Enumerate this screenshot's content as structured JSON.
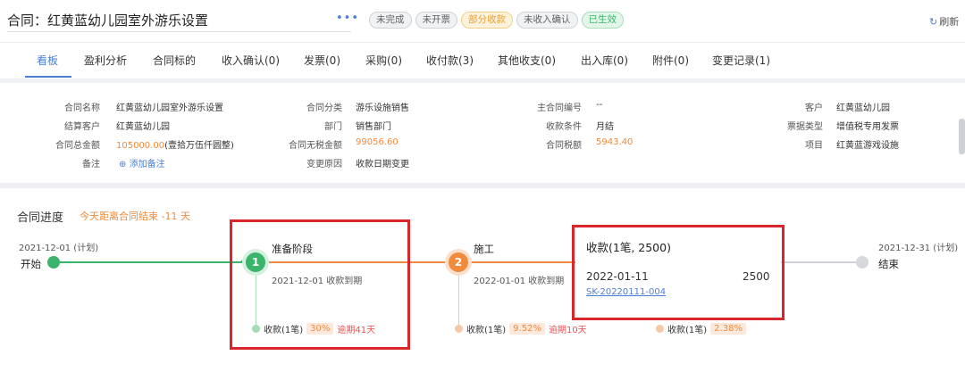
{
  "header": {
    "title": "合同：红黄蓝幼儿园室外游乐设置",
    "more": "•••",
    "tags": [
      {
        "label": "未完成",
        "style": "gray"
      },
      {
        "label": "未开票",
        "style": "gray"
      },
      {
        "label": "部分收款",
        "style": "orange"
      },
      {
        "label": "未收入确认",
        "style": "gray"
      },
      {
        "label": "已生效",
        "style": "green"
      }
    ],
    "refresh_label": "刷新",
    "refresh_icon": "refresh-icon"
  },
  "tabs": [
    {
      "label": "看板",
      "active": true
    },
    {
      "label": "盈利分析"
    },
    {
      "label": "合同标的"
    },
    {
      "label": "收入确认(0)"
    },
    {
      "label": "发票(0)"
    },
    {
      "label": "采购(0)"
    },
    {
      "label": "收付款(3)"
    },
    {
      "label": "其他收支(0)"
    },
    {
      "label": "出入库(0)"
    },
    {
      "label": "附件(0)"
    },
    {
      "label": "变更记录(1)"
    }
  ],
  "info": {
    "contract_name": {
      "label": "合同名称",
      "value": "红黄蓝幼儿园室外游乐设置"
    },
    "settle_customer": {
      "label": "结算客户",
      "value": "红黄蓝幼儿园"
    },
    "total_amount": {
      "label": "合同总金额",
      "value": "105000.00",
      "value_cn": "(壹拾万伍仟圆整)"
    },
    "remark": {
      "label": "备注",
      "add_label": "添加备注",
      "add_icon": "plus-circle-icon"
    },
    "category": {
      "label": "合同分类",
      "value": "游乐设施销售"
    },
    "department": {
      "label": "部门",
      "value": "销售部门"
    },
    "untaxed_amount": {
      "label": "合同无税金额",
      "value": "99056.60"
    },
    "change_reason": {
      "label": "变更原因",
      "value": "收款日期变更"
    },
    "main_contract_no": {
      "label": "主合同编号",
      "value": "--"
    },
    "payment_terms": {
      "label": "收款条件",
      "value": "月结"
    },
    "tax_amount": {
      "label": "合同税额",
      "value": "5943.40"
    },
    "customer": {
      "label": "客户",
      "value": "红黄蓝幼儿园"
    },
    "invoice_type": {
      "label": "票据类型",
      "value": "增值税专用发票"
    },
    "project": {
      "label": "项目",
      "value": "红黄蓝游戏设施"
    }
  },
  "progress": {
    "title": "合同进度",
    "countdown": "今天距离合同结束 -11 天",
    "start": {
      "date": "2021-12-01 (计划)",
      "label": "开始"
    },
    "end": {
      "date": "2021-12-31 (计划)",
      "label": "结束"
    },
    "stages": [
      {
        "number": "1",
        "name": "准备阶段",
        "due": "2021-12-01 收款到期",
        "stat_label": "收款(1笔)",
        "percent": "30%",
        "overdue": "逾期41天"
      },
      {
        "number": "2",
        "name": "施工",
        "due": "2022-01-01 收款到期",
        "stat_label": "收款(1笔)",
        "percent": "9.52%",
        "overdue": "逾期10天"
      },
      {
        "stat_label": "收款(1笔)",
        "percent": "2.38%"
      }
    ],
    "popup": {
      "title": "收款(1笔, 2500)",
      "date": "2022-01-11",
      "amount": "2500",
      "link": "SK-20220111-004"
    }
  },
  "colors": {
    "accent": "#4a7fd6",
    "green": "#3bb56b",
    "orange": "#f08a3c",
    "red": "#d9262b"
  }
}
